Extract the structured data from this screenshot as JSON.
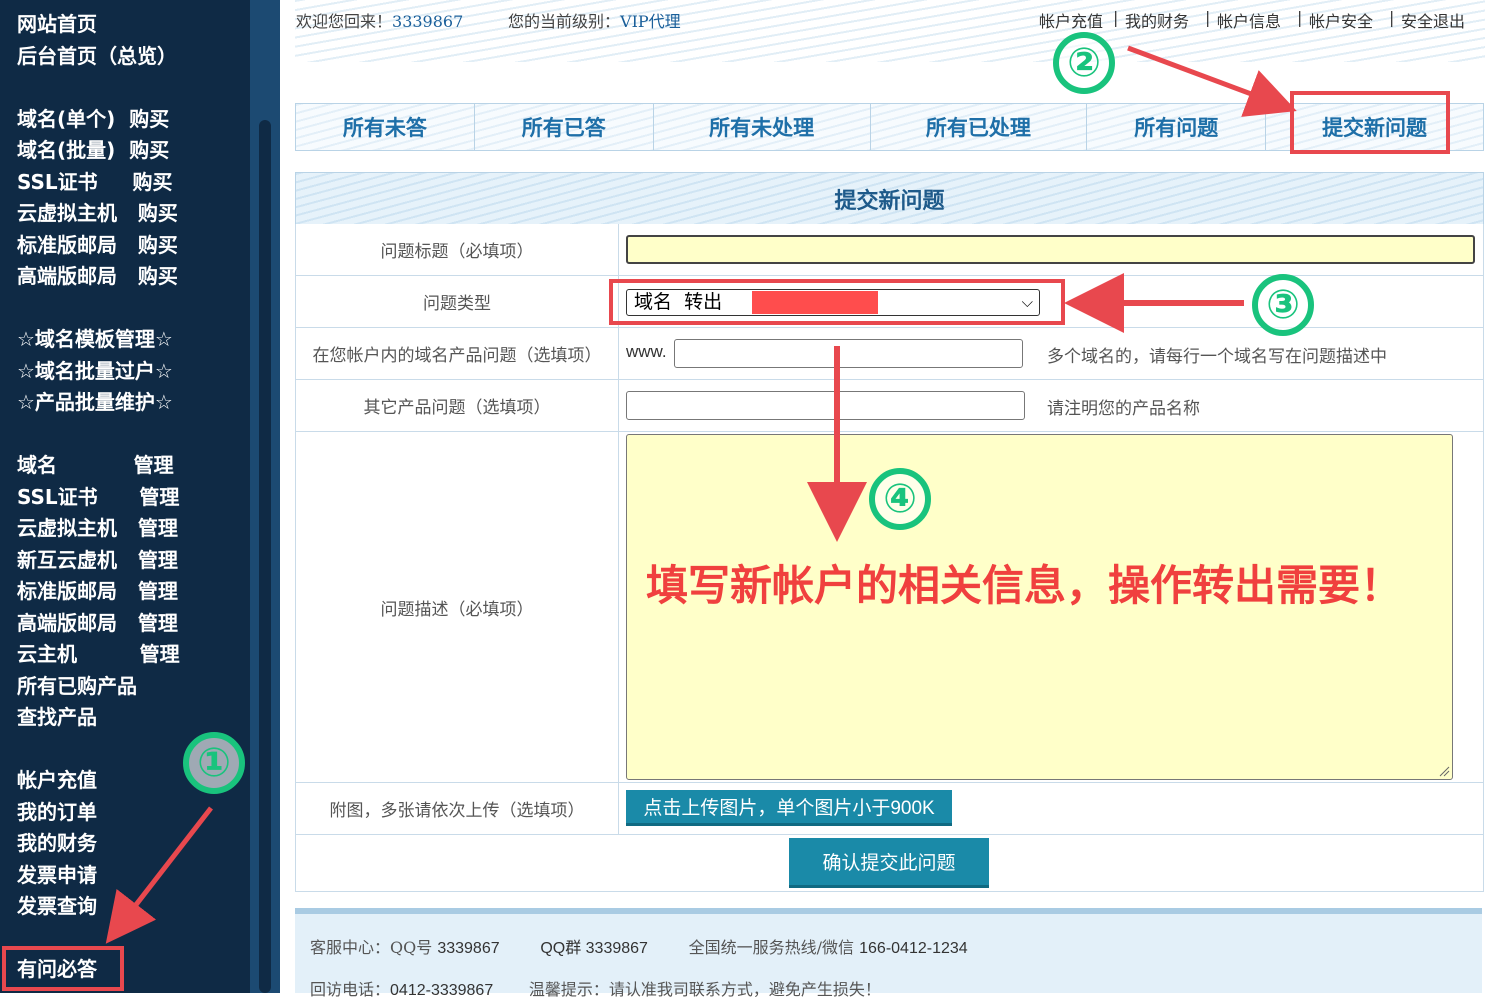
{
  "sidebar": {
    "items": [
      {
        "label": "网站首页"
      },
      {
        "label": "后台首页（总览）"
      },
      {
        "label": "域名(单个)  购买"
      },
      {
        "label": "域名(批量)  购买"
      },
      {
        "label": "SSL证书     购买"
      },
      {
        "label": "云虚拟主机   购买"
      },
      {
        "label": "标准版邮局   购买"
      },
      {
        "label": "高端版邮局   购买"
      },
      {
        "label": "☆域名模板管理☆"
      },
      {
        "label": "☆域名批量过户☆"
      },
      {
        "label": "☆产品批量维护☆"
      },
      {
        "label": "域名           管理"
      },
      {
        "label": "SSL证书      管理"
      },
      {
        "label": "云虚拟主机   管理"
      },
      {
        "label": "新互云虚机   管理"
      },
      {
        "label": "标准版邮局   管理"
      },
      {
        "label": "高端版邮局   管理"
      },
      {
        "label": "云主机         管理"
      },
      {
        "label": "所有已购产品"
      },
      {
        "label": "查找产品"
      },
      {
        "label": "帐户充值"
      },
      {
        "label": "我的订单"
      },
      {
        "label": "我的财务"
      },
      {
        "label": "发票申请"
      },
      {
        "label": "发票查询"
      },
      {
        "label": "有问必答"
      }
    ]
  },
  "topbar": {
    "welcome_prefix": "欢迎您回来！",
    "user_id": "3339867",
    "level_prefix": "您的当前级别：",
    "level": "VIP代理",
    "links": [
      "帐户充值",
      "我的财务",
      "帐户信息",
      "帐户安全",
      "安全退出"
    ]
  },
  "tabs": [
    "所有未答",
    "所有已答",
    "所有未处理",
    "所有已处理",
    "所有问题",
    "提交新问题"
  ],
  "form": {
    "title": "提交新问题",
    "question_title_label": "问题标题（必填项）",
    "question_type_label": "问题类型",
    "question_type_value": "域名  转出",
    "domain_label": "在您帐户内的域名产品问题（选填项）",
    "domain_prefix": "www.",
    "domain_hint": "多个域名的，请每行一个域名写在问题描述中",
    "other_label": "其它产品问题（选填项）",
    "other_hint": "请注明您的产品名称",
    "desc_label": "问题描述（必填项）",
    "attach_label": "附图，多张请依次上传（选填项）",
    "upload_button": "点击上传图片，单个图片小于900K",
    "submit_button": "确认提交此问题"
  },
  "footer": {
    "service_prefix": "客服中心：QQ号 ",
    "qq": "3339867",
    "group_prefix": "QQ群 ",
    "qq_group": "3339867",
    "hotline_prefix": "全国统一服务热线/微信 ",
    "hotline": "166-0412-1234",
    "callback_prefix": "回访电话：",
    "callback": "0412-3339867",
    "tip": "温馨提示：请认准我司联系方式，避免产生损失！"
  },
  "annotations": {
    "step1": "①",
    "step2": "②",
    "step3": "③",
    "step4": "④",
    "note": "填写新帐户的相关信息，操作转出需要！"
  },
  "colors": {
    "sidebar_bg": "#0f2a45",
    "tab_text": "#1e6fa8",
    "button_bg": "#1a8aa8",
    "annotation_red": "#e8484e",
    "annotation_green": "#19c37d",
    "textarea_bg": "#ffffc9"
  }
}
